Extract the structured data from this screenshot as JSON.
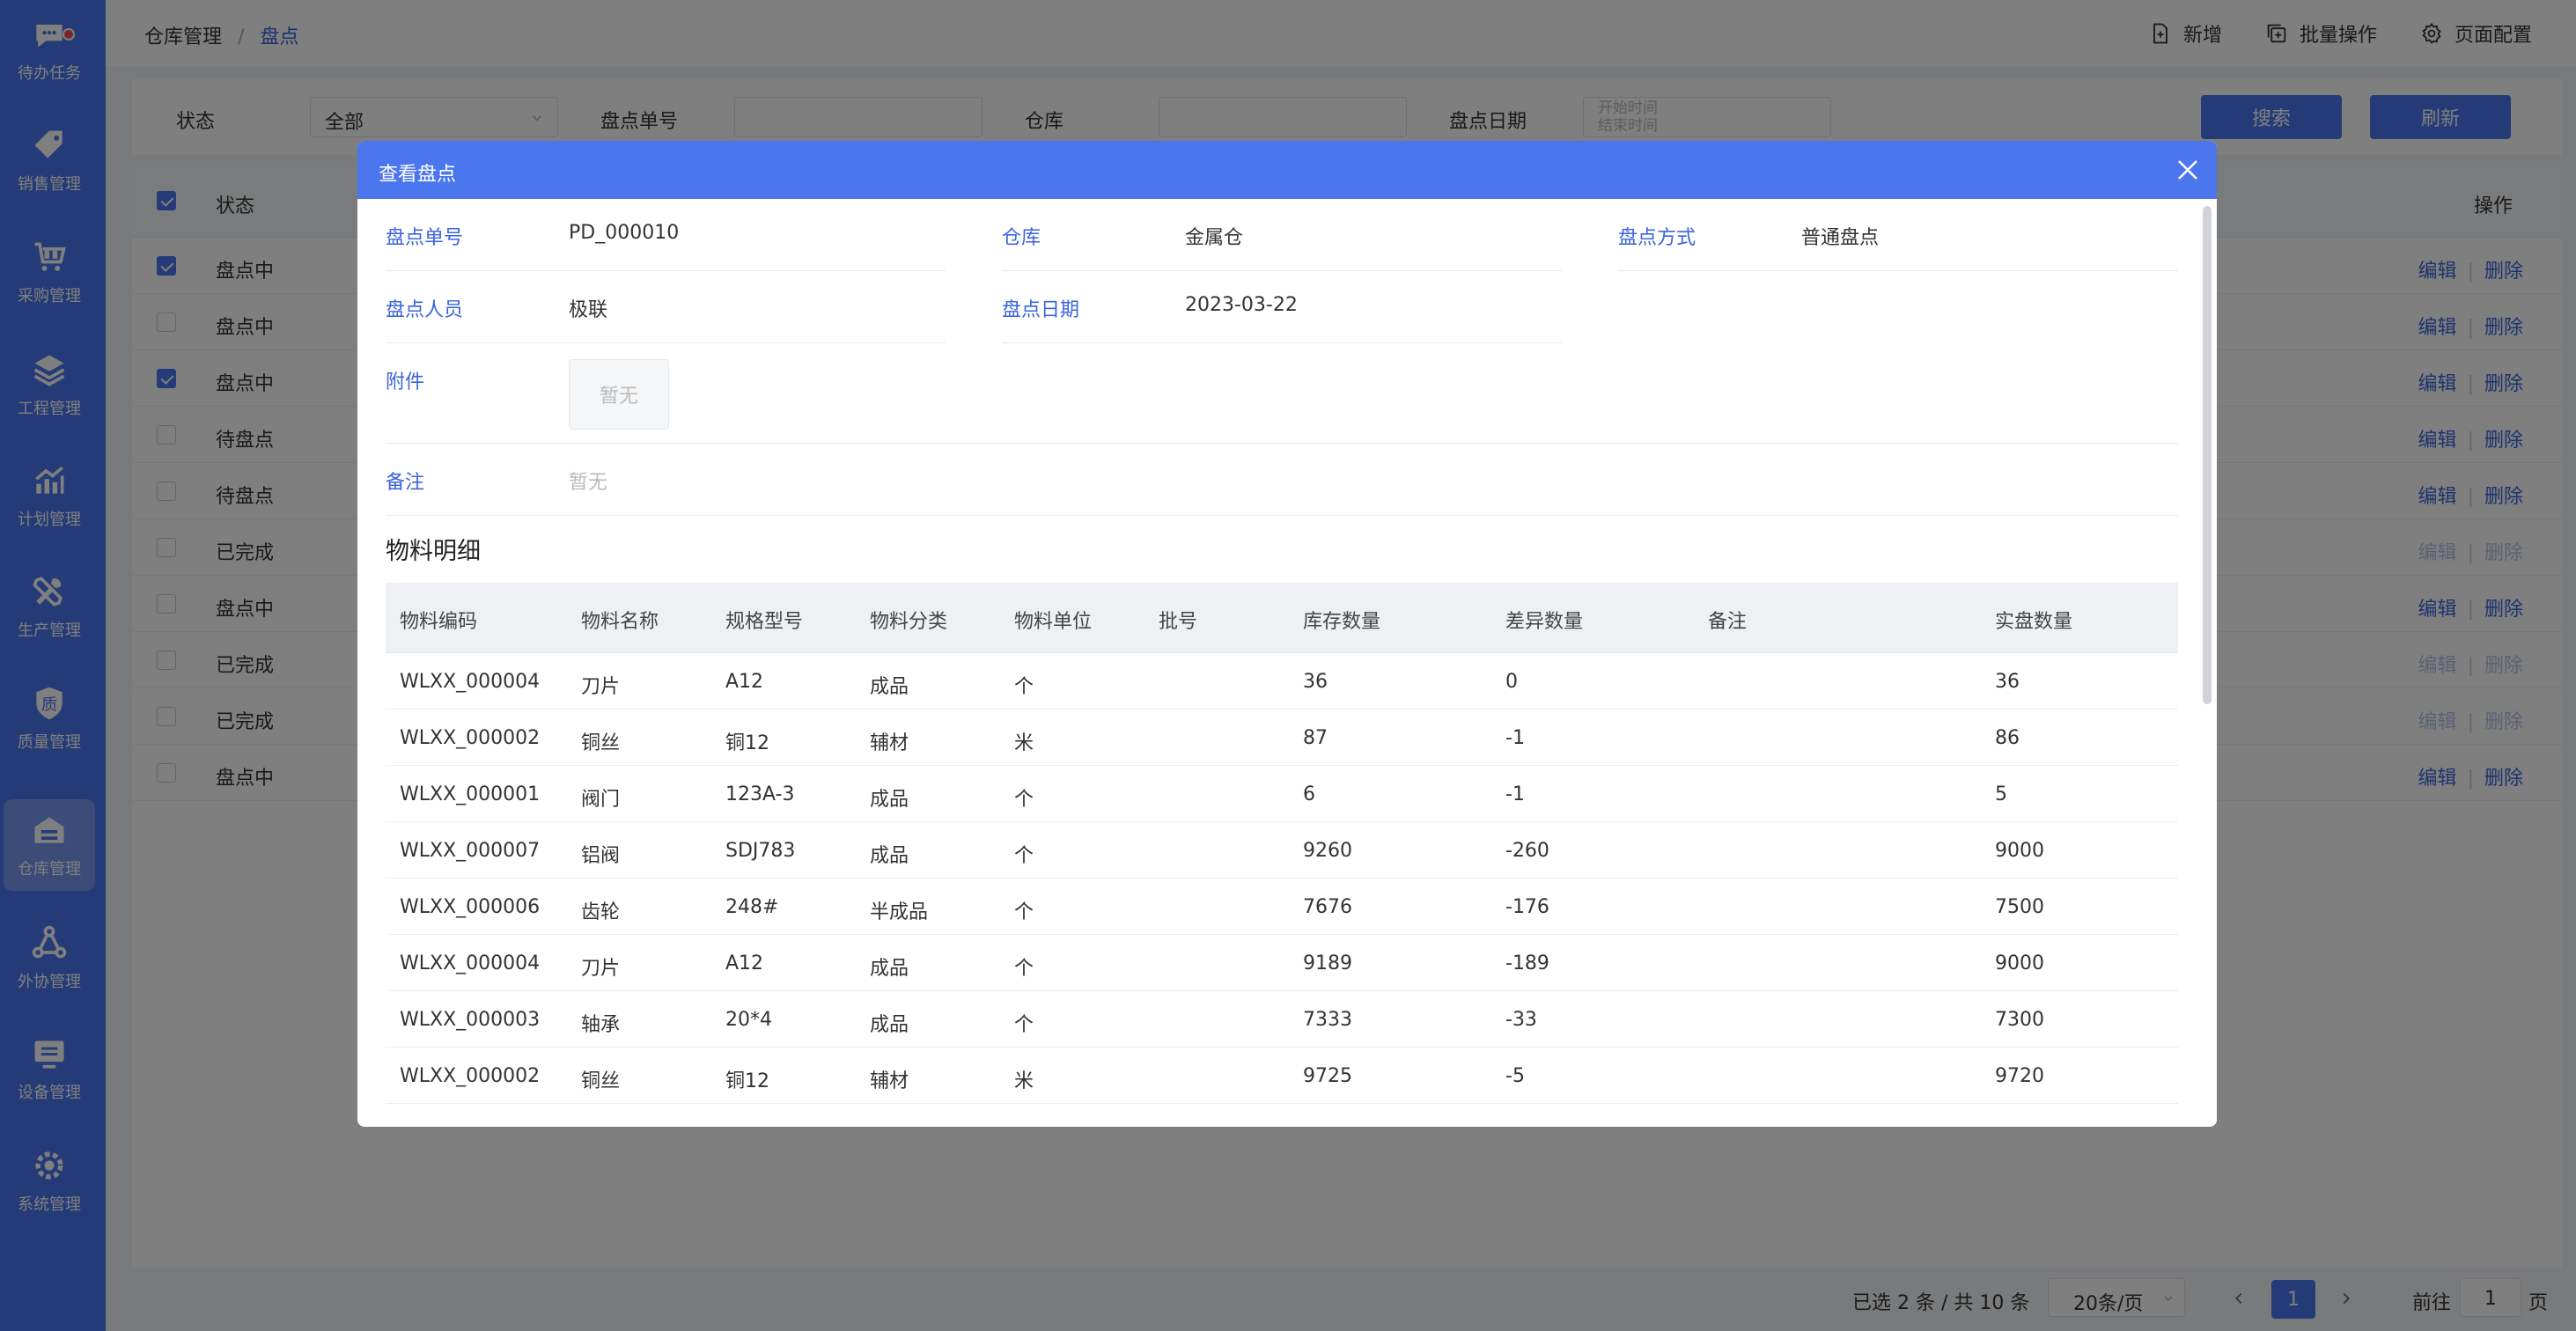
{
  "sidebar": {
    "items": [
      {
        "label": "待办任务",
        "icon": "chat-icon"
      },
      {
        "label": "销售管理",
        "icon": "tag-icon"
      },
      {
        "label": "采购管理",
        "icon": "cart-icon"
      },
      {
        "label": "工程管理",
        "icon": "layers-icon"
      },
      {
        "label": "计划管理",
        "icon": "chart-icon"
      },
      {
        "label": "生产管理",
        "icon": "tools-icon"
      },
      {
        "label": "质量管理",
        "icon": "shield-icon"
      },
      {
        "label": "仓库管理",
        "icon": "warehouse-icon"
      },
      {
        "label": "外协管理",
        "icon": "network-icon"
      },
      {
        "label": "设备管理",
        "icon": "monitor-icon"
      },
      {
        "label": "系统管理",
        "icon": "gear-icon"
      }
    ],
    "active_index": 7,
    "shield_glyph": "质"
  },
  "breadcrumb": {
    "parent": "仓库管理",
    "sep": "/",
    "current": "盘点"
  },
  "top_actions": {
    "add": "新增",
    "batch": "批量操作",
    "config": "页面配置"
  },
  "filters": {
    "status_label": "状态",
    "status_value": "全部",
    "order_label": "盘点单号",
    "warehouse_label": "仓库",
    "date_label": "盘点日期",
    "date_start_placeholder": "开始时间",
    "date_end_placeholder": "结束时间",
    "search_btn": "搜索",
    "refresh_btn": "刷新"
  },
  "list": {
    "header_status": "状态",
    "header_ops": "操作",
    "edit": "编辑",
    "delete": "删除",
    "pipe": "|",
    "rows": [
      {
        "status": "盘点中",
        "checked": true,
        "disabled": false
      },
      {
        "status": "盘点中",
        "checked": false,
        "disabled": false
      },
      {
        "status": "盘点中",
        "checked": true,
        "disabled": false
      },
      {
        "status": "待盘点",
        "checked": false,
        "disabled": false
      },
      {
        "status": "待盘点",
        "checked": false,
        "disabled": false
      },
      {
        "status": "已完成",
        "checked": false,
        "disabled": true
      },
      {
        "status": "盘点中",
        "checked": false,
        "disabled": false
      },
      {
        "status": "已完成",
        "checked": false,
        "disabled": true
      },
      {
        "status": "已完成",
        "checked": false,
        "disabled": true
      },
      {
        "status": "盘点中",
        "checked": false,
        "disabled": false
      }
    ]
  },
  "pager": {
    "summary": "已选 2 条 / 共 10 条",
    "page_size": "20条/页",
    "current_page": "1",
    "goto_prefix": "前往",
    "goto_value": "1",
    "goto_suffix": "页"
  },
  "modal": {
    "title": "查看盘点",
    "fields": {
      "order_no_label": "盘点单号",
      "order_no": "PD_000010",
      "warehouse_label": "仓库",
      "warehouse": "金属仓",
      "method_label": "盘点方式",
      "method": "普通盘点",
      "person_label": "盘点人员",
      "person": "极联",
      "date_label": "盘点日期",
      "date": "2023-03-22",
      "attach_label": "附件",
      "attach_empty": "暂无",
      "remark_label": "备注",
      "remark_empty": "暂无"
    },
    "section_title": "物料明细",
    "columns": [
      "物料编码",
      "物料名称",
      "规格型号",
      "物料分类",
      "物料单位",
      "批号",
      "库存数量",
      "差异数量",
      "备注",
      "实盘数量"
    ],
    "rows": [
      [
        "WLXX_000004",
        "刀片",
        "A12",
        "成品",
        "个",
        "",
        "36",
        "0",
        "",
        "36"
      ],
      [
        "WLXX_000002",
        "铜丝",
        "铜12",
        "辅材",
        "米",
        "",
        "87",
        "-1",
        "",
        "86"
      ],
      [
        "WLXX_000001",
        "阀门",
        "123A-3",
        "成品",
        "个",
        "",
        "6",
        "-1",
        "",
        "5"
      ],
      [
        "WLXX_000007",
        "铝阀",
        "SDJ783",
        "成品",
        "个",
        "",
        "9260",
        "-260",
        "",
        "9000"
      ],
      [
        "WLXX_000006",
        "齿轮",
        "248#",
        "半成品",
        "个",
        "",
        "7676",
        "-176",
        "",
        "7500"
      ],
      [
        "WLXX_000004",
        "刀片",
        "A12",
        "成品",
        "个",
        "",
        "9189",
        "-189",
        "",
        "9000"
      ],
      [
        "WLXX_000003",
        "轴承",
        "20*4",
        "成品",
        "个",
        "",
        "7333",
        "-33",
        "",
        "7300"
      ],
      [
        "WLXX_000002",
        "铜丝",
        "铜12",
        "辅材",
        "米",
        "",
        "9725",
        "-5",
        "",
        "9720"
      ]
    ]
  }
}
